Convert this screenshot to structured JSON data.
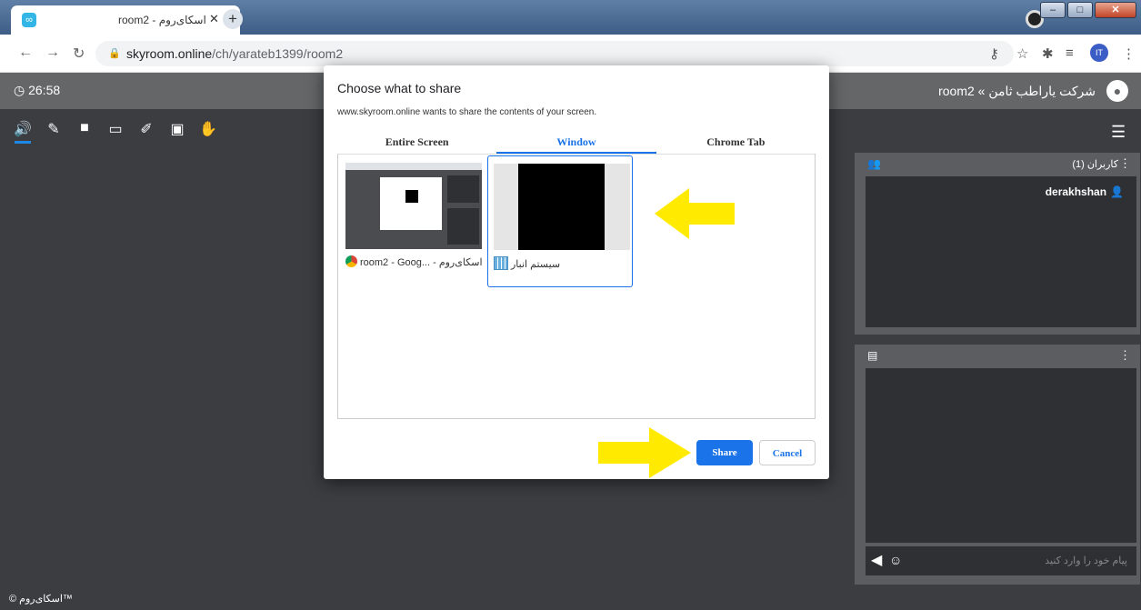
{
  "browser": {
    "tab_title": "room2 - اسکای‌روم",
    "new_tab": "+",
    "url_domain": "skyroom.online",
    "url_path": "/ch/yarateb1399/room2",
    "profile_initials": "IT"
  },
  "app": {
    "timer": "26:58",
    "room_title": "شرکت یاراطب ثامن » room2",
    "copyright": "™اسکای‌روم ©"
  },
  "users_panel": {
    "title": "کاربران (1)",
    "users": [
      "derakhshan"
    ]
  },
  "chat_panel": {
    "placeholder": "پیام خود را وارد کنید"
  },
  "dialog": {
    "title": "Choose what to share",
    "subtitle": "www.skyroom.online wants to share the contents of your screen.",
    "tabs": [
      "Entire Screen",
      "Window",
      "Chrome Tab"
    ],
    "active_tab": "Window",
    "windows": [
      {
        "label": "room2 - Goog... - اسکای‌روم",
        "icon": "chrome-icon"
      },
      {
        "label": "سیستم انبار",
        "icon": "app-icon"
      }
    ],
    "share_label": "Share",
    "cancel_label": "Cancel"
  },
  "colors": {
    "accent": "#1a73e8",
    "arrow": "#ffea00",
    "app_background": "#3b3d40"
  }
}
